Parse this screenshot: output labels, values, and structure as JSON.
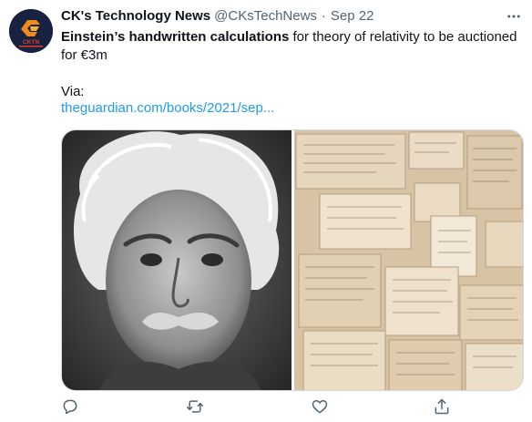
{
  "tweet": {
    "author": "CK's Technology News",
    "handle": "@CKsTechNews",
    "separator": "·",
    "date": "Sep 22",
    "avatar_text": "CKTN",
    "headline_bold": "Einstein’s handwritten calculations",
    "headline_rest": " for theory of relativity to be auctioned for €3m",
    "via_label": "Via:",
    "link_text": "theguardian.com/books/2021/sep...",
    "more_icon": "more-horizontal-icon"
  },
  "actions": [
    {
      "name": "reply-icon"
    },
    {
      "name": "retweet-icon"
    },
    {
      "name": "like-icon"
    },
    {
      "name": "share-icon"
    }
  ],
  "colors": {
    "link": "#1d9bf0",
    "secondary_text": "#536471",
    "avatar_bg": "#16223f",
    "avatar_accent": "#f08a1c"
  }
}
